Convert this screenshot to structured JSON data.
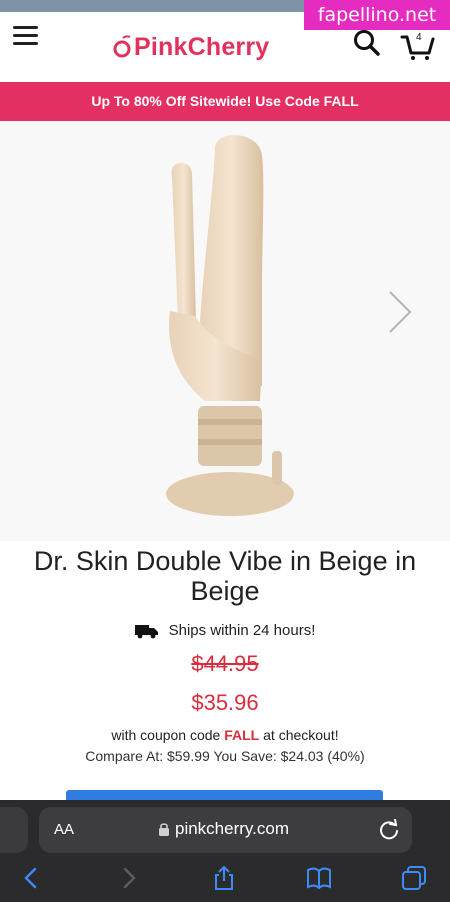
{
  "watermark": "fapellino.net",
  "header": {
    "logo_text": "PinkCherry",
    "cart_count": "4",
    "icons": [
      "hamburger-menu-icon",
      "cherry-logo-icon",
      "search-icon",
      "cart-icon"
    ]
  },
  "promo_banner": "Up To 80% Off Sitewide! Use Code FALL",
  "product": {
    "title": "Dr. Skin Double Vibe in Beige in Beige",
    "shipping": "Ships within 24 hours!",
    "original_price": "$44.95",
    "sale_price": "$35.96",
    "coupon_prefix": "with coupon code",
    "coupon_code": "FALL",
    "coupon_suffix": "at checkout!",
    "compare": "Compare At: $59.99 You Save: $24.03 (40%)"
  },
  "browser": {
    "aa_label": "AA",
    "url": "pinkcherry.com"
  },
  "colors": {
    "brand_pink": "#e0325b",
    "promo_bg": "#e32f61",
    "price_red": "#d92d3d",
    "watermark_bg": "#e62cc0",
    "button_blue": "#2f7de1",
    "browser_bg": "#2b2b2d"
  }
}
